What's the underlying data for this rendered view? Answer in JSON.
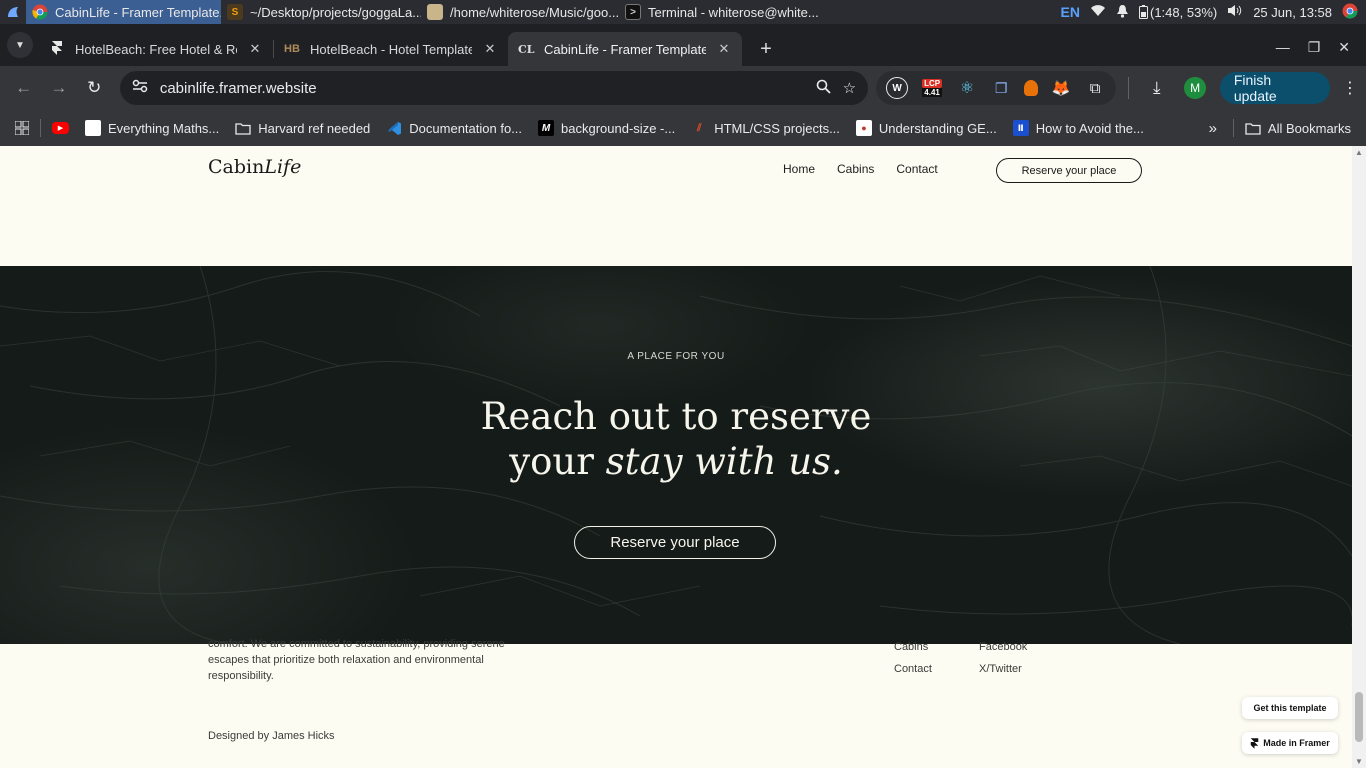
{
  "taskbar": {
    "tasks": [
      {
        "label": "CabinLife - Framer Template...",
        "icon": "chrome-icon",
        "active": true
      },
      {
        "label": "~/Desktop/projects/goggaLa...",
        "icon": "sublime-icon"
      },
      {
        "label": "/home/whiterose/Music/goo...",
        "icon": "folder-icon"
      },
      {
        "label": "Terminal - whiterose@white...",
        "icon": "terminal-icon"
      }
    ],
    "lang": "EN",
    "battery": "(1:48, 53%)",
    "clock": "25 Jun, 13:58"
  },
  "tabs": [
    {
      "favicon": "framer",
      "title": "HotelBeach: Free Hotel & Ren"
    },
    {
      "favicon": "HB",
      "title": "HotelBeach - Hotel Template"
    },
    {
      "favicon": "CL",
      "title": "CabinLife - Framer Template",
      "active": true
    }
  ],
  "toolbar": {
    "url": "cabinlife.framer.website",
    "lcp_badge_top": "LCP",
    "lcp_badge_value": "4.41",
    "avatar_letter": "M",
    "update_label": "Finish update"
  },
  "bookmarks": [
    {
      "label": "",
      "icon": "youtube-icon"
    },
    {
      "label": "Everything Maths...",
      "icon": "page-icon"
    },
    {
      "label": "Harvard ref needed",
      "icon": "folder-icon"
    },
    {
      "label": "Documentation fo...",
      "icon": "vscode-icon"
    },
    {
      "label": "background-size -...",
      "icon": "mdn-icon"
    },
    {
      "label": "HTML/CSS projects...",
      "icon": "codepen-icon"
    },
    {
      "label": "Understanding GE...",
      "icon": "page-icon"
    },
    {
      "label": "How to Avoid the...",
      "icon": "page-icon"
    }
  ],
  "bookmarks_all": "All Bookmarks",
  "site": {
    "logo_main": "Cabin",
    "logo_italic": "Life",
    "nav": [
      "Home",
      "Cabins",
      "Contact"
    ],
    "reserve_top": "Reserve your place",
    "hero": {
      "eyebrow": "A PLACE FOR YOU",
      "title_line1": "Reach out to reserve",
      "title_line2_plain": "your ",
      "title_line2_italic": "stay with us.",
      "button": "Reserve your place"
    },
    "footer": {
      "about_lines": [
        "comfort. We are committed to sustainability, providing serene",
        "escapes that prioritize both relaxation and environmental",
        "responsibility."
      ],
      "col_pages": [
        "Cabins",
        "Contact"
      ],
      "col_social": [
        "Facebook",
        "X/Twitter"
      ],
      "credit": "Designed by James Hicks"
    },
    "framer_badges": {
      "get_template": "Get this template",
      "made_in": "Made in Framer"
    }
  }
}
